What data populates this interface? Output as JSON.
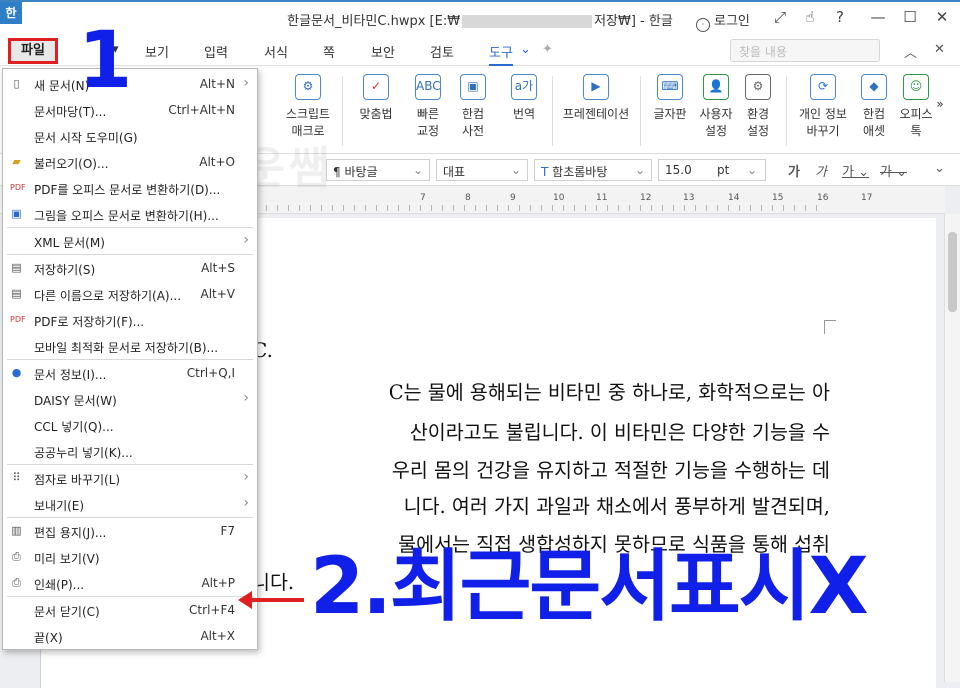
{
  "window": {
    "logo": "한",
    "title_prefix": "한글문서_비타민C.hwpx [E:₩",
    "title_suffix": "저장₩] - 한글",
    "login": "로그인",
    "controls": [
      "⤢",
      "☝",
      "?",
      "—",
      "☐",
      "✕"
    ]
  },
  "menubar": {
    "file": "파일",
    "items": [
      "보기",
      "입력",
      "서식",
      "쪽",
      "보안",
      "검토",
      "도구"
    ],
    "active": "도구",
    "search_placeholder": "찾을 내용"
  },
  "ribbon": {
    "tools": [
      {
        "label1": "스크립트",
        "label2": "매크로",
        "icon": "script-macro-icon"
      },
      {
        "label1": "맞춤법",
        "label2": "",
        "icon": "spell-check-icon"
      },
      {
        "label1": "빠른",
        "label2": "교정",
        "icon": "quick-correct-icon"
      },
      {
        "label1": "한컴",
        "label2": "사전",
        "icon": "dictionary-icon"
      },
      {
        "label1": "번역",
        "label2": "",
        "icon": "translate-icon"
      },
      {
        "label1": "프레젠테이션",
        "label2": "",
        "icon": "presentation-icon"
      },
      {
        "label1": "글자판",
        "label2": "",
        "icon": "keyboard-icon"
      },
      {
        "label1": "사용자",
        "label2": "설정",
        "icon": "user-settings-icon"
      },
      {
        "label1": "환경",
        "label2": "설정",
        "icon": "preferences-icon"
      },
      {
        "label1": "개인 정보",
        "label2": "바꾸기",
        "icon": "personal-info-icon"
      },
      {
        "label1": "한컴",
        "label2": "애셋",
        "icon": "hancom-asset-icon"
      },
      {
        "label1": "오피스",
        "label2": "톡",
        "icon": "office-talk-icon"
      }
    ]
  },
  "format": {
    "style": "바탕글",
    "type": "대표",
    "font": "함초롬바탕",
    "size": "15.0",
    "unit": "pt"
  },
  "ruler": {
    "ticks": [
      "7",
      "8",
      "9",
      "10",
      "11",
      "12",
      "13",
      "14",
      "15",
      "16",
      "17"
    ]
  },
  "file_menu": {
    "items": [
      {
        "label": "새 문서(N)",
        "shortcut": "Alt+N",
        "arrow": "›",
        "icon": "new-document-icon"
      },
      {
        "label": "문서마당(T)...",
        "shortcut": "Ctrl+Alt+N",
        "arrow": "",
        "icon": ""
      },
      {
        "label": "문서 시작 도우미(G)",
        "shortcut": "",
        "arrow": "",
        "icon": ""
      },
      {
        "label": "불러오기(O)...",
        "shortcut": "Alt+O",
        "arrow": "",
        "icon": "open-folder-icon"
      },
      {
        "label": "PDF를 오피스 문서로 변환하기(D)...",
        "shortcut": "",
        "arrow": "",
        "icon": "pdf-icon"
      },
      {
        "label": "그림을 오피스 문서로 변환하기(H)...",
        "shortcut": "",
        "arrow": "",
        "icon": "image-convert-icon"
      },
      {
        "label": "XML 문서(M)",
        "shortcut": "",
        "arrow": "›",
        "icon": ""
      },
      {
        "label": "저장하기(S)",
        "shortcut": "Alt+S",
        "arrow": "",
        "icon": "save-icon"
      },
      {
        "label": "다른 이름으로 저장하기(A)...",
        "shortcut": "Alt+V",
        "arrow": "",
        "icon": "save-as-icon"
      },
      {
        "label": "PDF로 저장하기(F)...",
        "shortcut": "",
        "arrow": "",
        "icon": "pdf-save-icon"
      },
      {
        "label": "모바일 최적화 문서로 저장하기(B)...",
        "shortcut": "",
        "arrow": "",
        "icon": ""
      },
      {
        "label": "문서 정보(I)...",
        "shortcut": "Ctrl+Q,I",
        "arrow": "",
        "icon": "info-icon"
      },
      {
        "label": "DAISY 문서(W)",
        "shortcut": "",
        "arrow": "›",
        "icon": ""
      },
      {
        "label": "CCL 넣기(Q)...",
        "shortcut": "",
        "arrow": "",
        "icon": ""
      },
      {
        "label": "공공누리 넣기(K)...",
        "shortcut": "",
        "arrow": "",
        "icon": ""
      },
      {
        "label": "점자로 바꾸기(L)",
        "shortcut": "",
        "arrow": "›",
        "icon": "braille-icon"
      },
      {
        "label": "보내기(E)",
        "shortcut": "",
        "arrow": "›",
        "icon": ""
      },
      {
        "label": "편집 용지(J)...",
        "shortcut": "F7",
        "arrow": "",
        "icon": "page-setup-icon"
      },
      {
        "label": "미리 보기(V)",
        "shortcut": "",
        "arrow": "",
        "icon": "print-preview-icon"
      },
      {
        "label": "인쇄(P)...",
        "shortcut": "Alt+P",
        "arrow": "",
        "icon": "print-icon"
      },
      {
        "label": "문서 닫기(C)",
        "shortcut": "Ctrl+F4",
        "arrow": "",
        "icon": ""
      },
      {
        "label": "끝(X)",
        "shortcut": "Alt+X",
        "arrow": "",
        "icon": ""
      }
    ]
  },
  "document": {
    "heading_fragment": "C.",
    "lines": [
      "C는 물에 용해되는 비타민 중 하나로, 화학적으로는 아",
      "산이라고도 불립니다. 이 비타민은 다양한 기능을 수",
      "우리 몸의 건강을 유지하고 적절한 기능을 수행하는 데",
      "니다. 여러 가지 과일과 채소에서 풍부하게 발견되며,",
      "물에서는 직접 생합성하지 못하므로 식품을 통해 섭취",
      "니다."
    ]
  },
  "watermark": "쉬운쌤",
  "annotations": {
    "step1": "1",
    "step2": "2.최근문서표시X"
  }
}
